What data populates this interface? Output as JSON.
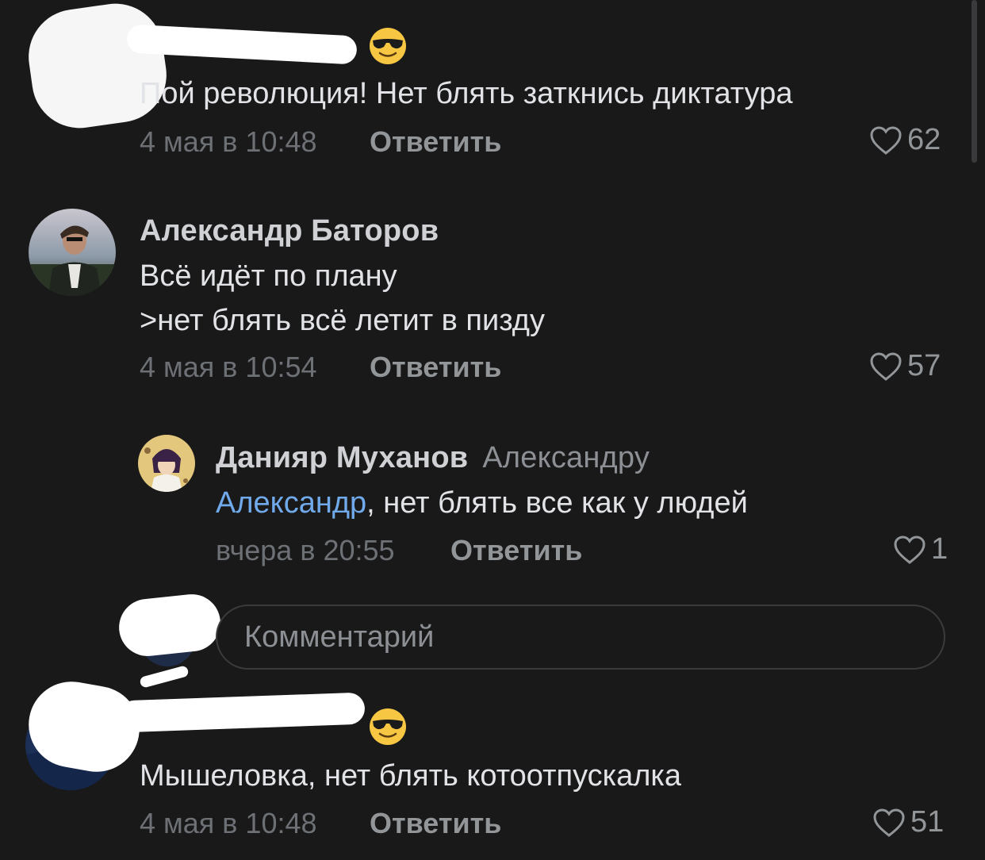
{
  "comments": [
    {
      "author": "",
      "text": "Пой революция! Нет блять заткнись диктатура",
      "time": "4 мая в 10:48",
      "reply_label": "Ответить",
      "likes": "62"
    },
    {
      "author": "Александр Баторов",
      "text_line1": "Всё идёт по плану",
      "text_line2": ">нет блять всё летит в пизду",
      "time": "4 мая в 10:54",
      "reply_label": "Ответить",
      "likes": "57"
    },
    {
      "author": "Данияр Муханов",
      "reply_to": "Александру",
      "mention": "Александр",
      "text": ", нет блять все как у людей",
      "time": "вчера в 20:55",
      "reply_label": "Ответить",
      "likes": "1"
    },
    {
      "author": "",
      "text": "Мышеловка, нет блять котоотпускалка",
      "time": "4 мая в 10:48",
      "reply_label": "Ответить",
      "likes": "51"
    }
  ],
  "comment_input": {
    "placeholder": "Комментарий"
  },
  "icons": {
    "like": "heart-outline-icon",
    "emoji": "sunglasses-emoji-icon"
  },
  "colors": {
    "background": "#19191a",
    "mention": "#71aaeb",
    "secondary_text": "#6d7075"
  }
}
